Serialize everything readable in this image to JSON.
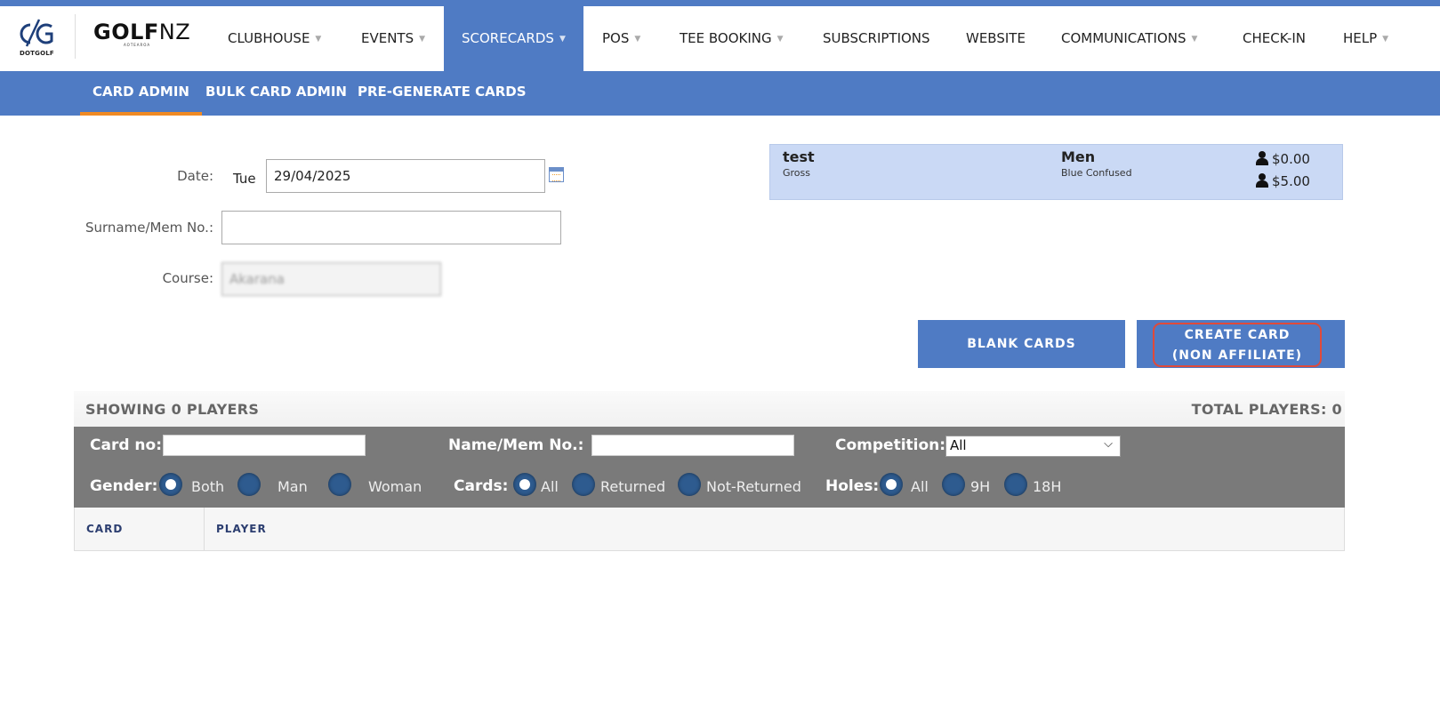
{
  "logos": {
    "dotgolf_text": "DOTGOLF",
    "golfnz_bold": "GOLF",
    "golfnz_light": "NZ",
    "golfnz_sub": "AOTEAROA"
  },
  "nav": {
    "clubhouse": "CLUBHOUSE",
    "events": "EVENTS",
    "scorecards": "SCORECARDS",
    "pos": "POS",
    "tee_booking": "TEE BOOKING",
    "subscriptions": "SUBSCRIPTIONS",
    "website": "WEBSITE",
    "communications": "COMMUNICATIONS",
    "checkin": "CHECK-IN",
    "help": "HELP",
    "caret": "▼"
  },
  "subnav": {
    "card_admin": "CARD ADMIN",
    "bulk_card_admin": "BULK CARD ADMIN",
    "pre_generate": "PRE-GENERATE CARDS"
  },
  "form": {
    "date_label": "Date:",
    "day": "Tue",
    "date_value": "29/04/2025",
    "surname_label": "Surname/Mem No.:",
    "surname_value": "",
    "course_label": "Course:",
    "course_value": "Akarana"
  },
  "competition": {
    "name": "test",
    "type": "Gross",
    "gender": "Men",
    "tee": "Blue Confused",
    "fee1": "$0.00",
    "fee2": "$5.00"
  },
  "buttons": {
    "blank_cards": "BLANK CARDS",
    "create_card_line1": "CREATE CARD",
    "create_card_line2": "(NON AFFILIATE)"
  },
  "players": {
    "showing": "SHOWING 0  PLAYERS",
    "total": "TOTAL PLAYERS: 0"
  },
  "filters": {
    "card_no": "Card no:",
    "name_mem": "Name/Mem No.:",
    "competition": "Competition:",
    "competition_value": "All",
    "gender": "Gender:",
    "gender_options": [
      "Both",
      "Man",
      "Woman"
    ],
    "cards": "Cards:",
    "cards_options": [
      "All",
      "Returned",
      "Not-Returned"
    ],
    "holes": "Holes:",
    "holes_options": [
      "All",
      "9H",
      "18H"
    ]
  },
  "table": {
    "col_card": "CARD",
    "col_player": "PLAYER"
  },
  "colors": {
    "brand_blue": "#4f7bc4",
    "highlight_red": "#e04a3a",
    "active_tab": "#f08a24"
  }
}
